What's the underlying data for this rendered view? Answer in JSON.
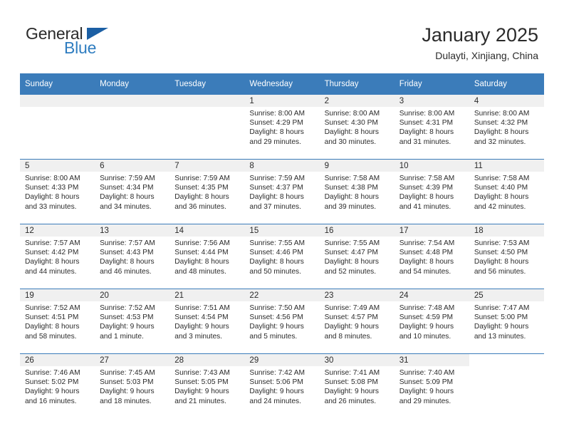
{
  "brand": {
    "name_part1": "General",
    "name_part2": "Blue",
    "accent_color": "#2f7dc0",
    "triangle_color": "#1b5fa4"
  },
  "header": {
    "title": "January 2025",
    "location": "Dulayti, Xinjiang, China"
  },
  "theme": {
    "header_band": "#3b7cba",
    "daynum_band": "#f0f0f0",
    "text": "#2b2b2b"
  },
  "weekday_headers": [
    "Sunday",
    "Monday",
    "Tuesday",
    "Wednesday",
    "Thursday",
    "Friday",
    "Saturday"
  ],
  "weeks": [
    [
      {
        "day": "",
        "blank": true,
        "sunrise": "",
        "sunset": "",
        "daylight1": "",
        "daylight2": ""
      },
      {
        "day": "",
        "blank": true,
        "sunrise": "",
        "sunset": "",
        "daylight1": "",
        "daylight2": ""
      },
      {
        "day": "",
        "blank": true,
        "sunrise": "",
        "sunset": "",
        "daylight1": "",
        "daylight2": ""
      },
      {
        "day": "1",
        "sunrise": "Sunrise: 8:00 AM",
        "sunset": "Sunset: 4:29 PM",
        "daylight1": "Daylight: 8 hours",
        "daylight2": "and 29 minutes."
      },
      {
        "day": "2",
        "sunrise": "Sunrise: 8:00 AM",
        "sunset": "Sunset: 4:30 PM",
        "daylight1": "Daylight: 8 hours",
        "daylight2": "and 30 minutes."
      },
      {
        "day": "3",
        "sunrise": "Sunrise: 8:00 AM",
        "sunset": "Sunset: 4:31 PM",
        "daylight1": "Daylight: 8 hours",
        "daylight2": "and 31 minutes."
      },
      {
        "day": "4",
        "sunrise": "Sunrise: 8:00 AM",
        "sunset": "Sunset: 4:32 PM",
        "daylight1": "Daylight: 8 hours",
        "daylight2": "and 32 minutes."
      }
    ],
    [
      {
        "day": "5",
        "sunrise": "Sunrise: 8:00 AM",
        "sunset": "Sunset: 4:33 PM",
        "daylight1": "Daylight: 8 hours",
        "daylight2": "and 33 minutes."
      },
      {
        "day": "6",
        "sunrise": "Sunrise: 7:59 AM",
        "sunset": "Sunset: 4:34 PM",
        "daylight1": "Daylight: 8 hours",
        "daylight2": "and 34 minutes."
      },
      {
        "day": "7",
        "sunrise": "Sunrise: 7:59 AM",
        "sunset": "Sunset: 4:35 PM",
        "daylight1": "Daylight: 8 hours",
        "daylight2": "and 36 minutes."
      },
      {
        "day": "8",
        "sunrise": "Sunrise: 7:59 AM",
        "sunset": "Sunset: 4:37 PM",
        "daylight1": "Daylight: 8 hours",
        "daylight2": "and 37 minutes."
      },
      {
        "day": "9",
        "sunrise": "Sunrise: 7:58 AM",
        "sunset": "Sunset: 4:38 PM",
        "daylight1": "Daylight: 8 hours",
        "daylight2": "and 39 minutes."
      },
      {
        "day": "10",
        "sunrise": "Sunrise: 7:58 AM",
        "sunset": "Sunset: 4:39 PM",
        "daylight1": "Daylight: 8 hours",
        "daylight2": "and 41 minutes."
      },
      {
        "day": "11",
        "sunrise": "Sunrise: 7:58 AM",
        "sunset": "Sunset: 4:40 PM",
        "daylight1": "Daylight: 8 hours",
        "daylight2": "and 42 minutes."
      }
    ],
    [
      {
        "day": "12",
        "sunrise": "Sunrise: 7:57 AM",
        "sunset": "Sunset: 4:42 PM",
        "daylight1": "Daylight: 8 hours",
        "daylight2": "and 44 minutes."
      },
      {
        "day": "13",
        "sunrise": "Sunrise: 7:57 AM",
        "sunset": "Sunset: 4:43 PM",
        "daylight1": "Daylight: 8 hours",
        "daylight2": "and 46 minutes."
      },
      {
        "day": "14",
        "sunrise": "Sunrise: 7:56 AM",
        "sunset": "Sunset: 4:44 PM",
        "daylight1": "Daylight: 8 hours",
        "daylight2": "and 48 minutes."
      },
      {
        "day": "15",
        "sunrise": "Sunrise: 7:55 AM",
        "sunset": "Sunset: 4:46 PM",
        "daylight1": "Daylight: 8 hours",
        "daylight2": "and 50 minutes."
      },
      {
        "day": "16",
        "sunrise": "Sunrise: 7:55 AM",
        "sunset": "Sunset: 4:47 PM",
        "daylight1": "Daylight: 8 hours",
        "daylight2": "and 52 minutes."
      },
      {
        "day": "17",
        "sunrise": "Sunrise: 7:54 AM",
        "sunset": "Sunset: 4:48 PM",
        "daylight1": "Daylight: 8 hours",
        "daylight2": "and 54 minutes."
      },
      {
        "day": "18",
        "sunrise": "Sunrise: 7:53 AM",
        "sunset": "Sunset: 4:50 PM",
        "daylight1": "Daylight: 8 hours",
        "daylight2": "and 56 minutes."
      }
    ],
    [
      {
        "day": "19",
        "sunrise": "Sunrise: 7:52 AM",
        "sunset": "Sunset: 4:51 PM",
        "daylight1": "Daylight: 8 hours",
        "daylight2": "and 58 minutes."
      },
      {
        "day": "20",
        "sunrise": "Sunrise: 7:52 AM",
        "sunset": "Sunset: 4:53 PM",
        "daylight1": "Daylight: 9 hours",
        "daylight2": "and 1 minute."
      },
      {
        "day": "21",
        "sunrise": "Sunrise: 7:51 AM",
        "sunset": "Sunset: 4:54 PM",
        "daylight1": "Daylight: 9 hours",
        "daylight2": "and 3 minutes."
      },
      {
        "day": "22",
        "sunrise": "Sunrise: 7:50 AM",
        "sunset": "Sunset: 4:56 PM",
        "daylight1": "Daylight: 9 hours",
        "daylight2": "and 5 minutes."
      },
      {
        "day": "23",
        "sunrise": "Sunrise: 7:49 AM",
        "sunset": "Sunset: 4:57 PM",
        "daylight1": "Daylight: 9 hours",
        "daylight2": "and 8 minutes."
      },
      {
        "day": "24",
        "sunrise": "Sunrise: 7:48 AM",
        "sunset": "Sunset: 4:59 PM",
        "daylight1": "Daylight: 9 hours",
        "daylight2": "and 10 minutes."
      },
      {
        "day": "25",
        "sunrise": "Sunrise: 7:47 AM",
        "sunset": "Sunset: 5:00 PM",
        "daylight1": "Daylight: 9 hours",
        "daylight2": "and 13 minutes."
      }
    ],
    [
      {
        "day": "26",
        "sunrise": "Sunrise: 7:46 AM",
        "sunset": "Sunset: 5:02 PM",
        "daylight1": "Daylight: 9 hours",
        "daylight2": "and 16 minutes."
      },
      {
        "day": "27",
        "sunrise": "Sunrise: 7:45 AM",
        "sunset": "Sunset: 5:03 PM",
        "daylight1": "Daylight: 9 hours",
        "daylight2": "and 18 minutes."
      },
      {
        "day": "28",
        "sunrise": "Sunrise: 7:43 AM",
        "sunset": "Sunset: 5:05 PM",
        "daylight1": "Daylight: 9 hours",
        "daylight2": "and 21 minutes."
      },
      {
        "day": "29",
        "sunrise": "Sunrise: 7:42 AM",
        "sunset": "Sunset: 5:06 PM",
        "daylight1": "Daylight: 9 hours",
        "daylight2": "and 24 minutes."
      },
      {
        "day": "30",
        "sunrise": "Sunrise: 7:41 AM",
        "sunset": "Sunset: 5:08 PM",
        "daylight1": "Daylight: 9 hours",
        "daylight2": "and 26 minutes."
      },
      {
        "day": "31",
        "sunrise": "Sunrise: 7:40 AM",
        "sunset": "Sunset: 5:09 PM",
        "daylight1": "Daylight: 9 hours",
        "daylight2": "and 29 minutes."
      },
      {
        "day": "",
        "empty": true,
        "sunrise": "",
        "sunset": "",
        "daylight1": "",
        "daylight2": ""
      }
    ]
  ]
}
